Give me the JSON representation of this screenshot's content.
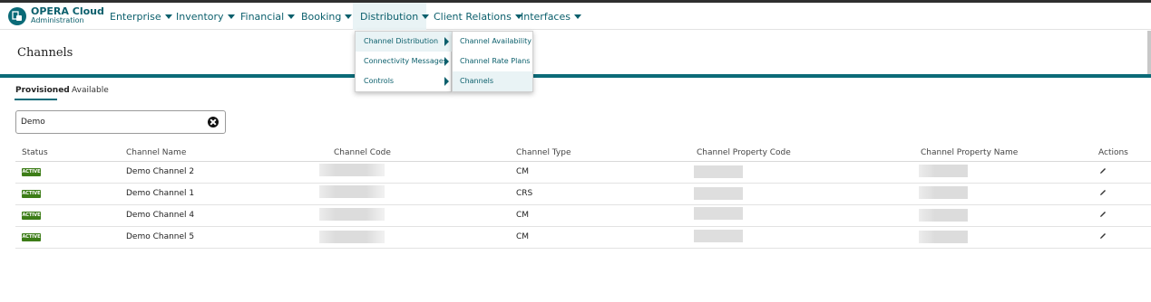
{
  "brand": {
    "line1": "OPERA Cloud",
    "line2": "Administration"
  },
  "nav": [
    {
      "label": "Enterprise"
    },
    {
      "label": "Inventory"
    },
    {
      "label": "Financial"
    },
    {
      "label": "Booking"
    },
    {
      "label": "Distribution"
    },
    {
      "label": "Client Relations"
    },
    {
      "label": "Interfaces"
    }
  ],
  "distribution_menu": [
    {
      "label": "Channel Distribution"
    },
    {
      "label": "Connectivity Messages"
    },
    {
      "label": "Controls"
    }
  ],
  "channel_distribution_submenu": [
    {
      "label": "Channel Availability"
    },
    {
      "label": "Channel Rate Plans"
    },
    {
      "label": "Channels"
    }
  ],
  "page": {
    "title": "Channels"
  },
  "tabs": [
    {
      "label": "Provisioned"
    },
    {
      "label": "Available"
    }
  ],
  "search": {
    "value": "Demo"
  },
  "table": {
    "headers": [
      "Status",
      "Channel Name",
      "Channel Code",
      "Channel Type",
      "Channel Property Code",
      "Channel Property Name",
      "Actions"
    ],
    "rows": [
      {
        "status": "ACTIVE",
        "name": "Demo Channel 2",
        "type": "CM"
      },
      {
        "status": "ACTIVE",
        "name": "Demo Channel 1",
        "type": "CRS"
      },
      {
        "status": "ACTIVE",
        "name": "Demo Channel 4",
        "type": "CM"
      },
      {
        "status": "ACTIVE",
        "name": "Demo Channel 5",
        "type": "CM"
      }
    ]
  },
  "colors": {
    "accent": "#0b6b78",
    "link": "#0b5f6c",
    "status_active": "#3d7d18"
  }
}
